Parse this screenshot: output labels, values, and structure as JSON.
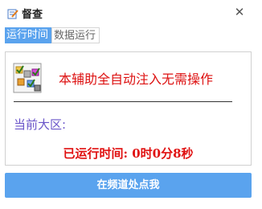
{
  "window": {
    "title": "督查",
    "close_glyph": "✕",
    "icon": "pencil-notepad-icon"
  },
  "tabs": [
    {
      "label": "运行时间",
      "active": true
    },
    {
      "label": "数据运行",
      "active": false
    }
  ],
  "panel": {
    "notice": "本辅助全自动注入无需操作",
    "region_label": "当前大区:",
    "runtime": "已运行时间: 0时0分8秒",
    "logo": "colored-checkboxes-icon"
  },
  "action_button": {
    "label": "在频道处点我"
  },
  "colors": {
    "accent": "#5aa3ee",
    "notice": "#dd1111",
    "region": "#6a55c9"
  }
}
